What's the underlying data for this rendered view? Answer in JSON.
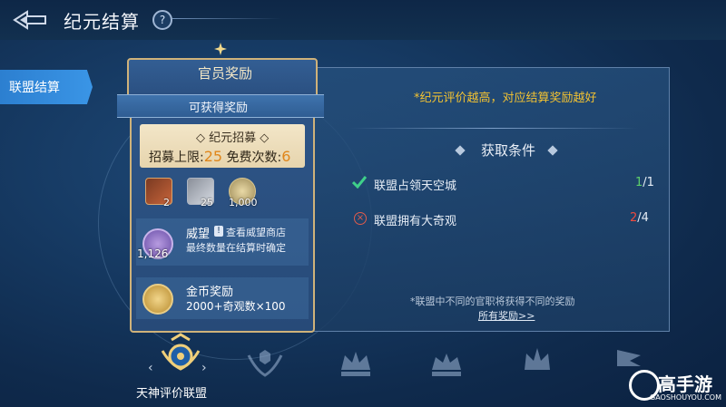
{
  "header": {
    "title": "纪元结算",
    "help_icon": "question-icon"
  },
  "sidebar": {
    "items": [
      {
        "label": "联盟结算",
        "active": true
      }
    ]
  },
  "reward_card": {
    "title": "官员奖励",
    "subtitle": "可获得奖励",
    "recruit": {
      "title": "纪元招募",
      "limit_label": "招募上限:",
      "limit_value": "25",
      "free_label": "免费次数:",
      "free_value": "6"
    },
    "items": [
      {
        "icon": "book-icon",
        "count": "2"
      },
      {
        "icon": "statue-icon",
        "count": "25"
      },
      {
        "icon": "coin-icon",
        "count": "1,000"
      }
    ],
    "prestige": {
      "icon": "prestige-icon",
      "count": "1,126",
      "title": "威望",
      "link": "查看威望商店",
      "desc": "最终数量在结算时确定"
    },
    "gold": {
      "icon": "gold-coin-icon",
      "title": "金币奖励",
      "desc": "2000+奇观数×100"
    }
  },
  "conditions_panel": {
    "tip": "*纪元评价越高，对应结算奖励越好",
    "title": "获取条件",
    "rows": [
      {
        "label": "联盟占领天空城",
        "current": "1",
        "total": "/1",
        "status": "done"
      },
      {
        "label": "联盟拥有大奇观",
        "current": "2",
        "total": "/4",
        "status": "failed"
      }
    ],
    "note": "*联盟中不同的官职将获得不同的奖励",
    "all_rewards_link": "所有奖励>>"
  },
  "ranks": {
    "selected_label": "天神评价联盟",
    "crests": [
      "wing-crest-icon",
      "crown-icon",
      "crown-icon",
      "crown-icon",
      "flag-icon"
    ]
  },
  "watermark": {
    "text": "高手游",
    "sub": "GAOSHOUYOU.COM"
  },
  "colors": {
    "accent_gold": "#f2c232",
    "success": "#5ed06a",
    "danger": "#ef4a3e",
    "tab_blue": "#2c7fd0"
  }
}
